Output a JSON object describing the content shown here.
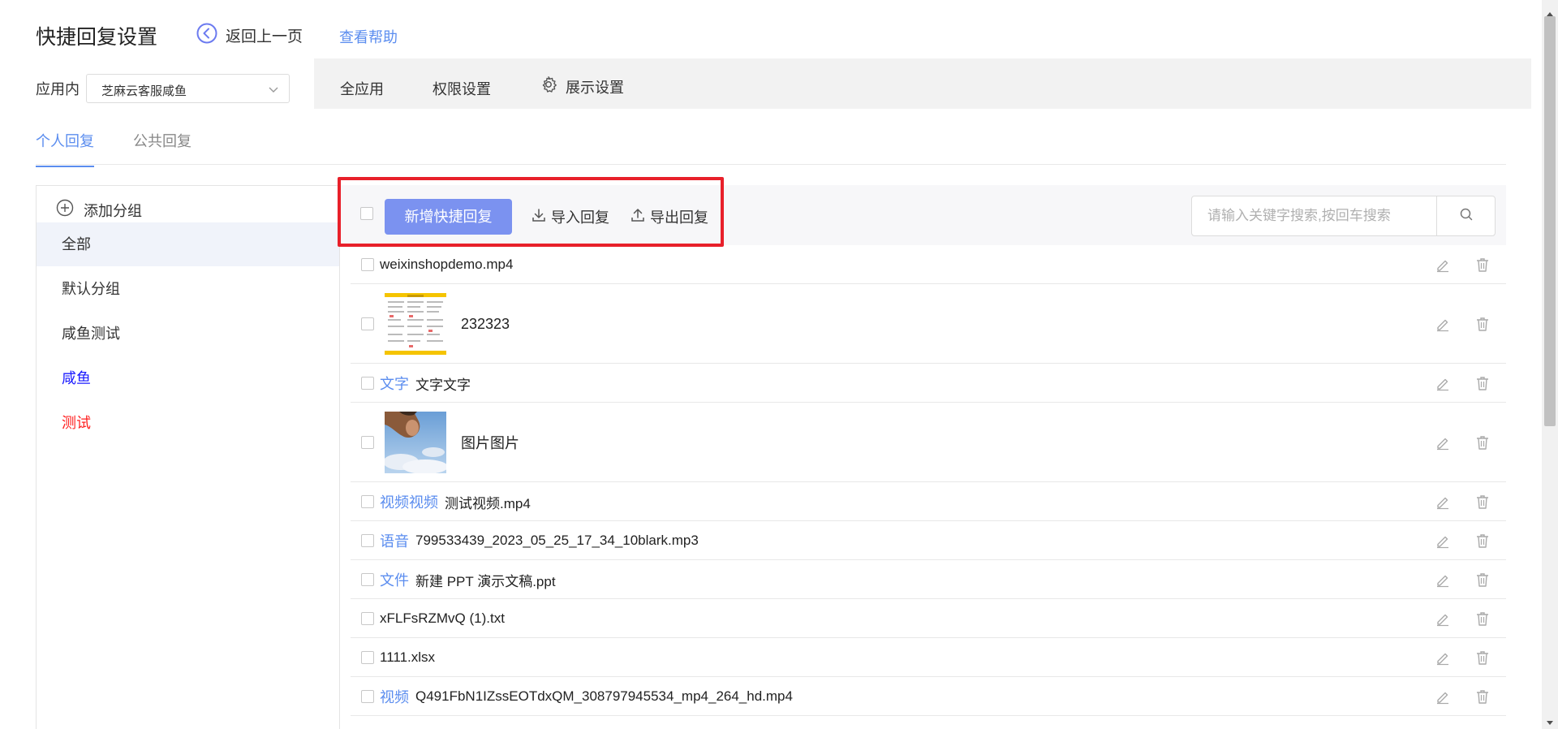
{
  "header": {
    "title": "快捷回复设置",
    "back_label": "返回上一页",
    "help_label": "查看帮助"
  },
  "scope": {
    "label": "应用内",
    "selected_app": "芝麻云客服咸鱼",
    "nav": {
      "all_apps": "全应用",
      "permissions": "权限设置",
      "display": "展示设置"
    }
  },
  "tabs": {
    "personal": "个人回复",
    "public": "公共回复",
    "active": "personal"
  },
  "groups": {
    "add_label": "添加分组",
    "items": [
      {
        "label": "全部",
        "color": "#333333",
        "selected": true
      },
      {
        "label": "默认分组",
        "color": "#333333",
        "selected": false
      },
      {
        "label": "咸鱼测试",
        "color": "#333333",
        "selected": false
      },
      {
        "label": "咸鱼",
        "color": "#1a1aff",
        "selected": false
      },
      {
        "label": "测试",
        "color": "#ff2020",
        "selected": false
      }
    ]
  },
  "toolbar": {
    "add_label": "新增快捷回复",
    "import_label": "导入回复",
    "export_label": "导出回复",
    "search_placeholder": "请输入关键字搜索,按回车搜索"
  },
  "replies": [
    {
      "type": "",
      "text": "weixinshopdemo.mp4",
      "thumb": null
    },
    {
      "type": "",
      "text": "232323",
      "thumb": "doc"
    },
    {
      "type": "文字",
      "text": "文字文字",
      "thumb": null
    },
    {
      "type": "",
      "text": "图片图片",
      "thumb": "photo"
    },
    {
      "type": "视频视频",
      "text": "测试视频.mp4",
      "thumb": null
    },
    {
      "type": "语音",
      "text": "799533439_2023_05_25_17_34_10blark.mp3",
      "thumb": null
    },
    {
      "type": "文件",
      "text": "新建 PPT 演示文稿.ppt",
      "thumb": null
    },
    {
      "type": "",
      "text": "xFLFsRZMvQ (1).txt",
      "thumb": null
    },
    {
      "type": "",
      "text": "1111.xlsx",
      "thumb": null
    },
    {
      "type": "视频",
      "text": "Q491FbN1IZssEOTdxQM_308797945534_mp4_264_hd.mp4",
      "thumb": null
    }
  ],
  "colors": {
    "accent": "#5b8def",
    "primary_button": "#7b92f0",
    "highlight": "#e8202a"
  }
}
